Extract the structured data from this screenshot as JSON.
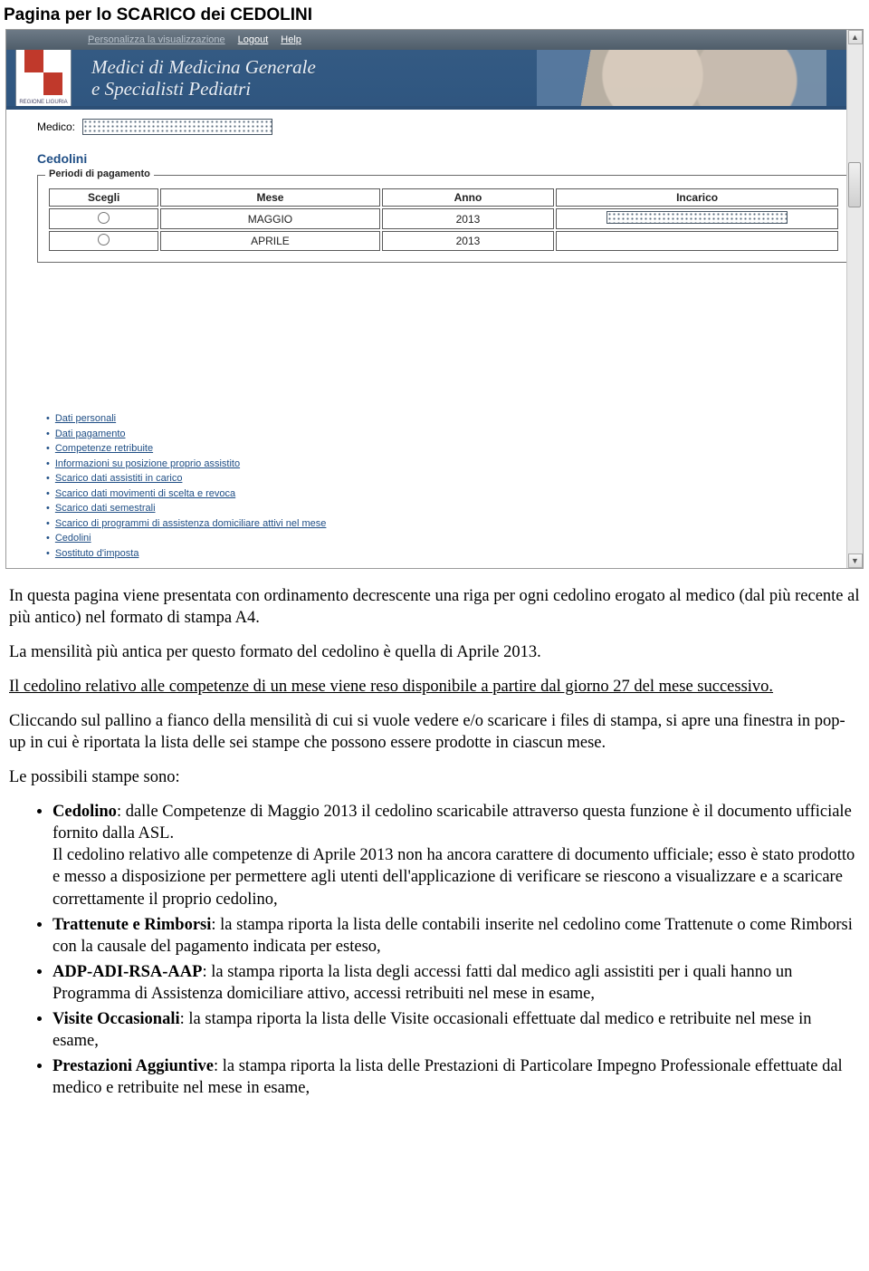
{
  "doc": {
    "title": "Pagina per lo SCARICO dei CEDOLINI"
  },
  "topmenu": {
    "personalize": "Personalizza la visualizzazione",
    "logout": "Logout",
    "help": "Help"
  },
  "brand": {
    "line1": "Medici di Medicina Generale",
    "line2": "e Specialisti Pediatri",
    "logo_label": "REGIONE LIGURIA"
  },
  "content": {
    "medico_label": "Medico:",
    "page_subtitle": "Cedolini",
    "fieldset_legend": "Periodi di pagamento",
    "table": {
      "headers": {
        "scegli": "Scegli",
        "mese": "Mese",
        "anno": "Anno",
        "incarico": "Incarico"
      },
      "rows": [
        {
          "mese": "MAGGIO",
          "anno": "2013"
        },
        {
          "mese": "APRILE",
          "anno": "2013"
        }
      ]
    },
    "links": [
      "Dati personali",
      "Dati pagamento",
      "Competenze retribuite",
      "Informazioni su posizione proprio assistito",
      "Scarico dati assistiti in carico",
      "Scarico dati movimenti di scelta e revoca",
      "Scarico dati semestrali",
      "Scarico di programmi di assistenza domiciliare attivi nel mese",
      "Cedolini",
      "Sostituto d'imposta"
    ]
  },
  "prose": {
    "p1": "In questa pagina viene presentata con ordinamento decrescente una riga per ogni cedolino erogato al medico (dal più recente al più antico) nel formato di stampa A4.",
    "p2": "La mensilità più antica per questo formato del cedolino è quella di Aprile 2013.",
    "p3": "Il cedolino relativo alle competenze di un mese viene reso disponibile a partire dal giorno 27 del mese successivo.",
    "p4": "Cliccando sul pallino a fianco della mensilità di cui si vuole vedere e/o scaricare i files di stampa, si apre una finestra in pop-up in cui è riportata la lista delle sei stampe che possono essere prodotte in ciascun mese.",
    "p5": "Le possibili stampe sono:",
    "bullets": {
      "b1_bold": "Cedolino",
      "b1_rest": ": dalle Competenze di Maggio 2013 il cedolino scaricabile attraverso questa funzione è il documento ufficiale fornito dalla ASL.",
      "b1_p2": "Il cedolino relativo alle competenze di Aprile 2013 non ha ancora carattere di documento ufficiale; esso è stato prodotto e messo a disposizione per permettere agli utenti dell'applicazione di verificare se riescono a visualizzare e a scaricare correttamente il proprio cedolino,",
      "b2_bold": "Trattenute e Rimborsi",
      "b2_rest": ": la stampa riporta la lista delle contabili inserite nel cedolino come Trattenute o come Rimborsi con la causale del pagamento indicata per esteso,",
      "b3_bold": "ADP-ADI-RSA-AAP",
      "b3_rest": ": la stampa riporta la lista degli accessi fatti dal medico agli assistiti per i quali hanno un Programma di Assistenza domiciliare attivo, accessi retribuiti nel mese in esame,",
      "b4_bold": "Visite Occasionali",
      "b4_rest": ": la stampa riporta la lista delle Visite occasionali effettuate dal medico e retribuite nel mese in esame,",
      "b5_bold": "Prestazioni Aggiuntive",
      "b5_rest": ": la stampa riporta la lista delle Prestazioni di Particolare Impegno Professionale effettuate dal medico e retribuite nel mese in esame,"
    }
  }
}
